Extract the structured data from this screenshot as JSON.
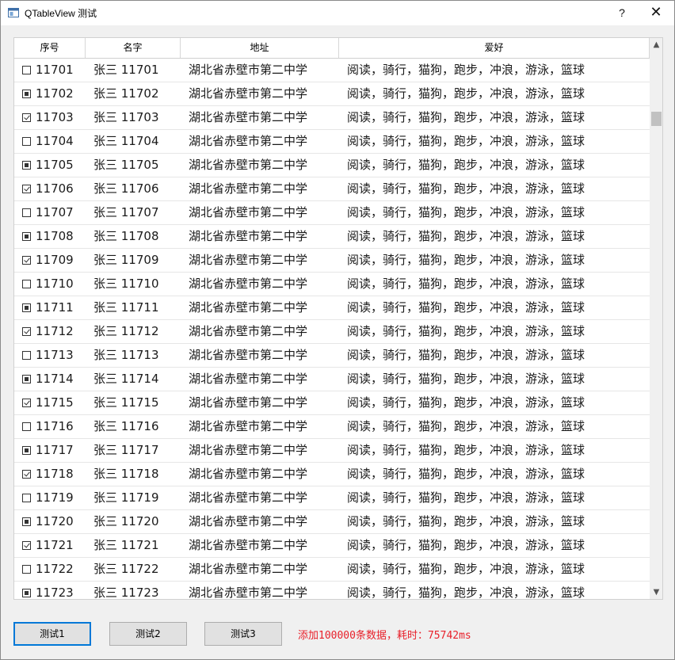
{
  "window": {
    "title": "QTableView 测试",
    "help_label": "?",
    "close_label": "✕"
  },
  "table": {
    "headers": [
      "序号",
      "名字",
      "地址",
      "爱好"
    ],
    "rows": [
      {
        "check": "unchecked",
        "id": "11701",
        "name": "张三  11701",
        "address": "湖北省赤壁市第二中学",
        "hobby": "阅读，骑行，猫狗，跑步，冲浪，游泳，篮球"
      },
      {
        "check": "partial",
        "id": "11702",
        "name": "张三  11702",
        "address": "湖北省赤壁市第二中学",
        "hobby": "阅读，骑行，猫狗，跑步，冲浪，游泳，篮球"
      },
      {
        "check": "checked",
        "id": "11703",
        "name": "张三  11703",
        "address": "湖北省赤壁市第二中学",
        "hobby": "阅读，骑行，猫狗，跑步，冲浪，游泳，篮球"
      },
      {
        "check": "unchecked",
        "id": "11704",
        "name": "张三  11704",
        "address": "湖北省赤壁市第二中学",
        "hobby": "阅读，骑行，猫狗，跑步，冲浪，游泳，篮球"
      },
      {
        "check": "partial",
        "id": "11705",
        "name": "张三  11705",
        "address": "湖北省赤壁市第二中学",
        "hobby": "阅读，骑行，猫狗，跑步，冲浪，游泳，篮球"
      },
      {
        "check": "checked",
        "id": "11706",
        "name": "张三  11706",
        "address": "湖北省赤壁市第二中学",
        "hobby": "阅读，骑行，猫狗，跑步，冲浪，游泳，篮球"
      },
      {
        "check": "unchecked",
        "id": "11707",
        "name": "张三  11707",
        "address": "湖北省赤壁市第二中学",
        "hobby": "阅读，骑行，猫狗，跑步，冲浪，游泳，篮球"
      },
      {
        "check": "partial",
        "id": "11708",
        "name": "张三  11708",
        "address": "湖北省赤壁市第二中学",
        "hobby": "阅读，骑行，猫狗，跑步，冲浪，游泳，篮球"
      },
      {
        "check": "checked",
        "id": "11709",
        "name": "张三  11709",
        "address": "湖北省赤壁市第二中学",
        "hobby": "阅读，骑行，猫狗，跑步，冲浪，游泳，篮球"
      },
      {
        "check": "unchecked",
        "id": "11710",
        "name": "张三  11710",
        "address": "湖北省赤壁市第二中学",
        "hobby": "阅读，骑行，猫狗，跑步，冲浪，游泳，篮球"
      },
      {
        "check": "partial",
        "id": "11711",
        "name": "张三  11711",
        "address": "湖北省赤壁市第二中学",
        "hobby": "阅读，骑行，猫狗，跑步，冲浪，游泳，篮球"
      },
      {
        "check": "checked",
        "id": "11712",
        "name": "张三  11712",
        "address": "湖北省赤壁市第二中学",
        "hobby": "阅读，骑行，猫狗，跑步，冲浪，游泳，篮球"
      },
      {
        "check": "unchecked",
        "id": "11713",
        "name": "张三  11713",
        "address": "湖北省赤壁市第二中学",
        "hobby": "阅读，骑行，猫狗，跑步，冲浪，游泳，篮球"
      },
      {
        "check": "partial",
        "id": "11714",
        "name": "张三  11714",
        "address": "湖北省赤壁市第二中学",
        "hobby": "阅读，骑行，猫狗，跑步，冲浪，游泳，篮球"
      },
      {
        "check": "checked",
        "id": "11715",
        "name": "张三  11715",
        "address": "湖北省赤壁市第二中学",
        "hobby": "阅读，骑行，猫狗，跑步，冲浪，游泳，篮球"
      },
      {
        "check": "unchecked",
        "id": "11716",
        "name": "张三  11716",
        "address": "湖北省赤壁市第二中学",
        "hobby": "阅读，骑行，猫狗，跑步，冲浪，游泳，篮球"
      },
      {
        "check": "partial",
        "id": "11717",
        "name": "张三  11717",
        "address": "湖北省赤壁市第二中学",
        "hobby": "阅读，骑行，猫狗，跑步，冲浪，游泳，篮球"
      },
      {
        "check": "checked",
        "id": "11718",
        "name": "张三  11718",
        "address": "湖北省赤壁市第二中学",
        "hobby": "阅读，骑行，猫狗，跑步，冲浪，游泳，篮球"
      },
      {
        "check": "unchecked",
        "id": "11719",
        "name": "张三  11719",
        "address": "湖北省赤壁市第二中学",
        "hobby": "阅读，骑行，猫狗，跑步，冲浪，游泳，篮球"
      },
      {
        "check": "partial",
        "id": "11720",
        "name": "张三  11720",
        "address": "湖北省赤壁市第二中学",
        "hobby": "阅读，骑行，猫狗，跑步，冲浪，游泳，篮球"
      },
      {
        "check": "checked",
        "id": "11721",
        "name": "张三  11721",
        "address": "湖北省赤壁市第二中学",
        "hobby": "阅读，骑行，猫狗，跑步，冲浪，游泳，篮球"
      },
      {
        "check": "unchecked",
        "id": "11722",
        "name": "张三  11722",
        "address": "湖北省赤壁市第二中学",
        "hobby": "阅读，骑行，猫狗，跑步，冲浪，游泳，篮球"
      },
      {
        "check": "partial",
        "id": "11723",
        "name": "张三  11723",
        "address": "湖北省赤壁市第二中学",
        "hobby": "阅读，骑行，猫狗，跑步，冲浪，游泳，篮球"
      }
    ]
  },
  "scrollbar": {
    "up_glyph": "▲",
    "down_glyph": "▼",
    "icon": "scroll-arrow-icon"
  },
  "buttons": {
    "test1": "测试1",
    "test2": "测试2",
    "test3": "测试3"
  },
  "status": {
    "message": "添加100000条数据，耗时：75742ms",
    "color": "#e8212b"
  },
  "colors": {
    "focus_border": "#0078d7"
  }
}
